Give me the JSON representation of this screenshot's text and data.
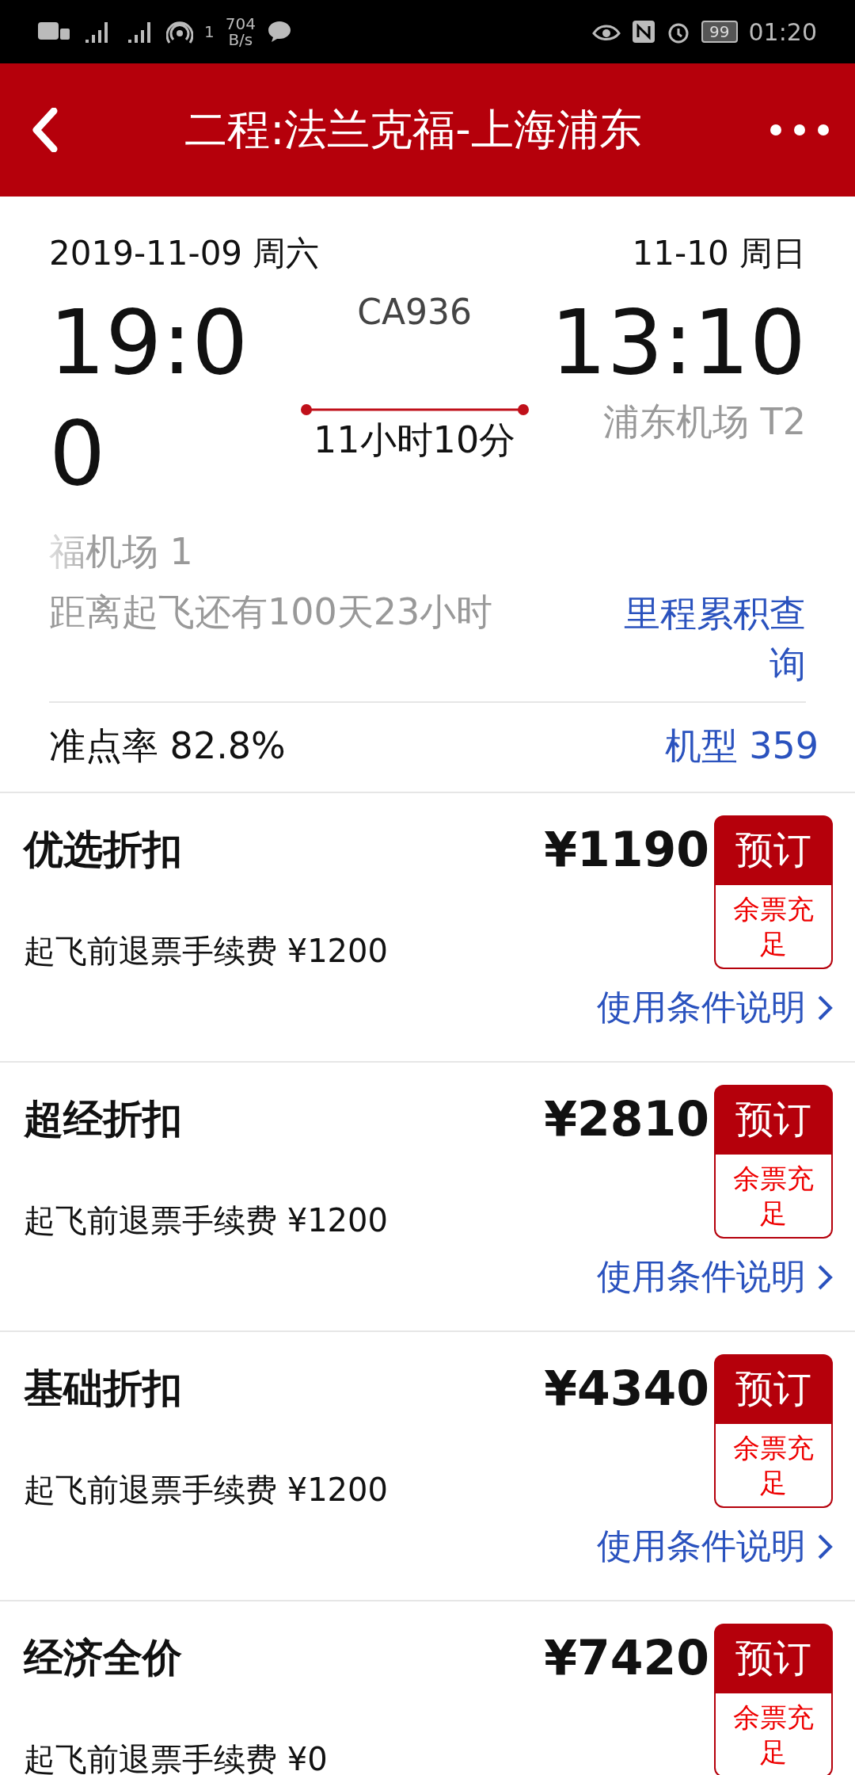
{
  "status_bar": {
    "network_speed": "704",
    "speed_unit": "B/s",
    "hotspot_count": "1",
    "battery": "99",
    "time": "01:20"
  },
  "header": {
    "title": "二程:法兰克福-上海浦东"
  },
  "flight": {
    "depart_date": "2019-11-09 周六",
    "arrive_date": "11-10 周日",
    "flight_no": "CA936",
    "depart_time": "19:00",
    "arrive_time": "13:10",
    "duration": "11小时10分",
    "arrive_airport": "浦东机场 T2",
    "depart_airport": "福机场 1",
    "countdown": "距离起飞还有100天23小时",
    "mileage_link": "里程累积查询",
    "on_time_rate": "准点率 82.8%",
    "aircraft_link": "机型 359"
  },
  "fares": [
    {
      "name": "优选折扣",
      "price": "¥1190",
      "book": "预订",
      "availability": "余票充足",
      "refund": "起飞前退票手续费 ¥1200",
      "terms_link": "使用条件说明"
    },
    {
      "name": "超经折扣",
      "price": "¥2810",
      "book": "预订",
      "availability": "余票充足",
      "refund": "起飞前退票手续费 ¥1200",
      "terms_link": "使用条件说明"
    },
    {
      "name": "基础折扣",
      "price": "¥4340",
      "book": "预订",
      "availability": "余票充足",
      "refund": "起飞前退票手续费 ¥1200",
      "terms_link": "使用条件说明"
    },
    {
      "name": "经济全价",
      "price": "¥7420",
      "book": "预订",
      "availability": "余票充足",
      "refund": "起飞前退票手续费 ¥0"
    }
  ]
}
